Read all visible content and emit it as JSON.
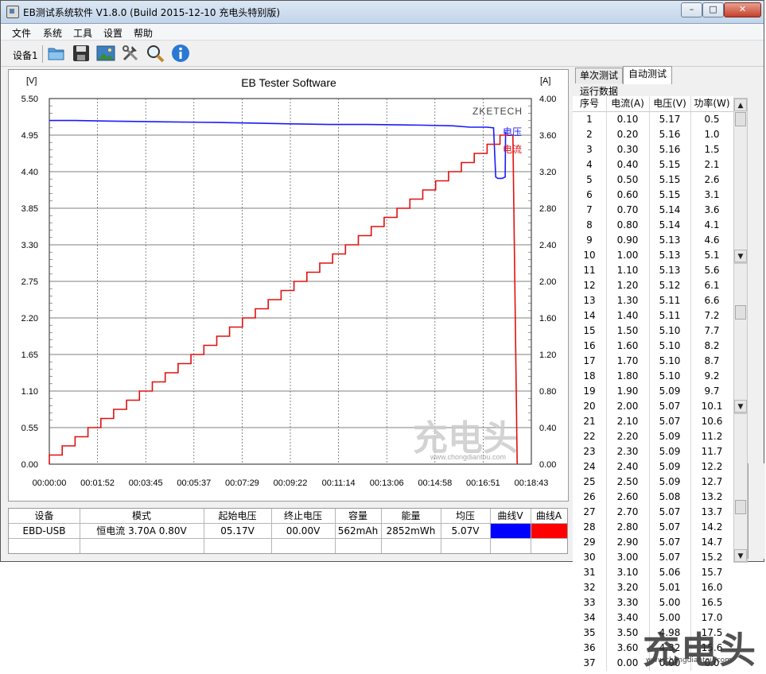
{
  "window": {
    "title": "EB测试系统软件 V1.8.0 (Build 2015-12-10 充电头特别版)",
    "minimize_glyph": "–",
    "restore_glyph": "□",
    "close_glyph": "✕"
  },
  "menu": {
    "items": [
      "文件",
      "系统",
      "工具",
      "设置",
      "帮助"
    ]
  },
  "toolbar": {
    "device_label": "设备1",
    "icons": [
      "open-folder-icon",
      "save-icon",
      "picture-icon",
      "tools-icon",
      "search-icon",
      "info-icon"
    ]
  },
  "chart_data": {
    "type": "line",
    "title": "EB Tester Software",
    "watermark": "ZKETECH",
    "y_left_unit": "[V]",
    "y_right_unit": "[A]",
    "y_left_ticks": [
      "5.50",
      "4.95",
      "4.40",
      "3.85",
      "3.30",
      "2.75",
      "2.20",
      "1.65",
      "1.10",
      "0.55",
      "0.00"
    ],
    "y_right_ticks": [
      "4.00",
      "3.60",
      "3.20",
      "2.80",
      "2.40",
      "2.00",
      "1.60",
      "1.20",
      "0.80",
      "0.40",
      "0.00"
    ],
    "x_ticks": [
      "00:00:00",
      "00:01:52",
      "00:03:45",
      "00:05:37",
      "00:07:29",
      "00:09:22",
      "00:11:14",
      "00:13:06",
      "00:14:58",
      "00:16:51",
      "00:18:43"
    ],
    "ylim_left": [
      0,
      5.5
    ],
    "ylim_right": [
      0,
      4.0
    ],
    "xlim_seconds": [
      0,
      1123
    ],
    "grid": true,
    "series": [
      {
        "name": "电压",
        "color": "#1a1aff",
        "axis": "left",
        "points": [
          [
            0,
            5.17
          ],
          [
            60,
            5.17
          ],
          [
            150,
            5.16
          ],
          [
            270,
            5.15
          ],
          [
            390,
            5.14
          ],
          [
            480,
            5.13
          ],
          [
            560,
            5.12
          ],
          [
            650,
            5.11
          ],
          [
            740,
            5.11
          ],
          [
            870,
            5.1
          ],
          [
            940,
            5.09
          ],
          [
            980,
            5.07
          ],
          [
            1020,
            5.07
          ],
          [
            1035,
            5.06
          ],
          [
            1040,
            4.32
          ],
          [
            1045,
            4.3
          ],
          [
            1055,
            4.3
          ],
          [
            1062,
            4.32
          ],
          [
            1063,
            5.0
          ]
        ]
      },
      {
        "name": "电流",
        "color": "#e01010",
        "axis": "right",
        "steps": [
          0.1,
          0.2,
          0.3,
          0.4,
          0.5,
          0.6,
          0.7,
          0.8,
          0.9,
          1.0,
          1.1,
          1.2,
          1.3,
          1.4,
          1.5,
          1.6,
          1.7,
          1.8,
          1.9,
          2.0,
          2.1,
          2.2,
          2.3,
          2.4,
          2.5,
          2.6,
          2.7,
          2.8,
          2.9,
          3.0,
          3.1,
          3.2,
          3.3,
          3.4,
          3.5,
          3.6
        ],
        "step_seconds": 30,
        "end_seconds": 1090
      }
    ]
  },
  "summary": {
    "headers": [
      "设备",
      "模式",
      "起始电压",
      "终止电压",
      "容量",
      "能量",
      "均压",
      "曲线V",
      "曲线A"
    ],
    "row": [
      "EBD-USB",
      "恒电流  3.70A  0.80V",
      "05.17V",
      "00.00V",
      "562mAh",
      "2852mWh",
      "5.07V"
    ],
    "curve_v_color": "#0000ff",
    "curve_a_color": "#ff0000"
  },
  "tabs": {
    "items": [
      "单次测试",
      "自动测试"
    ],
    "active": 1
  },
  "run_data": {
    "label": "运行数据",
    "headers": [
      "序号",
      "电流(A)",
      "电压(V)",
      "功率(W)"
    ],
    "rows": [
      [
        "1",
        "0.10",
        "5.17",
        "0.5"
      ],
      [
        "2",
        "0.20",
        "5.16",
        "1.0"
      ],
      [
        "3",
        "0.30",
        "5.16",
        "1.5"
      ],
      [
        "4",
        "0.40",
        "5.15",
        "2.1"
      ],
      [
        "5",
        "0.50",
        "5.15",
        "2.6"
      ],
      [
        "6",
        "0.60",
        "5.15",
        "3.1"
      ],
      [
        "7",
        "0.70",
        "5.14",
        "3.6"
      ],
      [
        "8",
        "0.80",
        "5.14",
        "4.1"
      ],
      [
        "9",
        "0.90",
        "5.13",
        "4.6"
      ],
      [
        "10",
        "1.00",
        "5.13",
        "5.1"
      ],
      [
        "11",
        "1.10",
        "5.13",
        "5.6"
      ],
      [
        "12",
        "1.20",
        "5.12",
        "6.1"
      ],
      [
        "13",
        "1.30",
        "5.11",
        "6.6"
      ],
      [
        "14",
        "1.40",
        "5.11",
        "7.2"
      ],
      [
        "15",
        "1.50",
        "5.10",
        "7.7"
      ],
      [
        "16",
        "1.60",
        "5.10",
        "8.2"
      ],
      [
        "17",
        "1.70",
        "5.10",
        "8.7"
      ],
      [
        "18",
        "1.80",
        "5.10",
        "9.2"
      ],
      [
        "19",
        "1.90",
        "5.09",
        "9.7"
      ],
      [
        "20",
        "2.00",
        "5.07",
        "10.1"
      ],
      [
        "21",
        "2.10",
        "5.07",
        "10.6"
      ],
      [
        "22",
        "2.20",
        "5.09",
        "11.2"
      ],
      [
        "23",
        "2.30",
        "5.09",
        "11.7"
      ],
      [
        "24",
        "2.40",
        "5.09",
        "12.2"
      ],
      [
        "25",
        "2.50",
        "5.09",
        "12.7"
      ],
      [
        "26",
        "2.60",
        "5.08",
        "13.2"
      ],
      [
        "27",
        "2.70",
        "5.07",
        "13.7"
      ],
      [
        "28",
        "2.80",
        "5.07",
        "14.2"
      ],
      [
        "29",
        "2.90",
        "5.07",
        "14.7"
      ],
      [
        "30",
        "3.00",
        "5.07",
        "15.2"
      ],
      [
        "31",
        "3.10",
        "5.06",
        "15.7"
      ],
      [
        "32",
        "3.20",
        "5.01",
        "16.0"
      ],
      [
        "33",
        "3.30",
        "5.00",
        "16.5"
      ],
      [
        "34",
        "3.40",
        "5.00",
        "17.0"
      ],
      [
        "35",
        "3.50",
        "4.98",
        "17.5"
      ],
      [
        "36",
        "3.60",
        "4.32",
        "15.6"
      ],
      [
        "37",
        "0.00",
        "0.00",
        "0.0"
      ]
    ]
  },
  "watermarks": {
    "site": "www.chongdiantou.com",
    "logo": "充电头"
  }
}
